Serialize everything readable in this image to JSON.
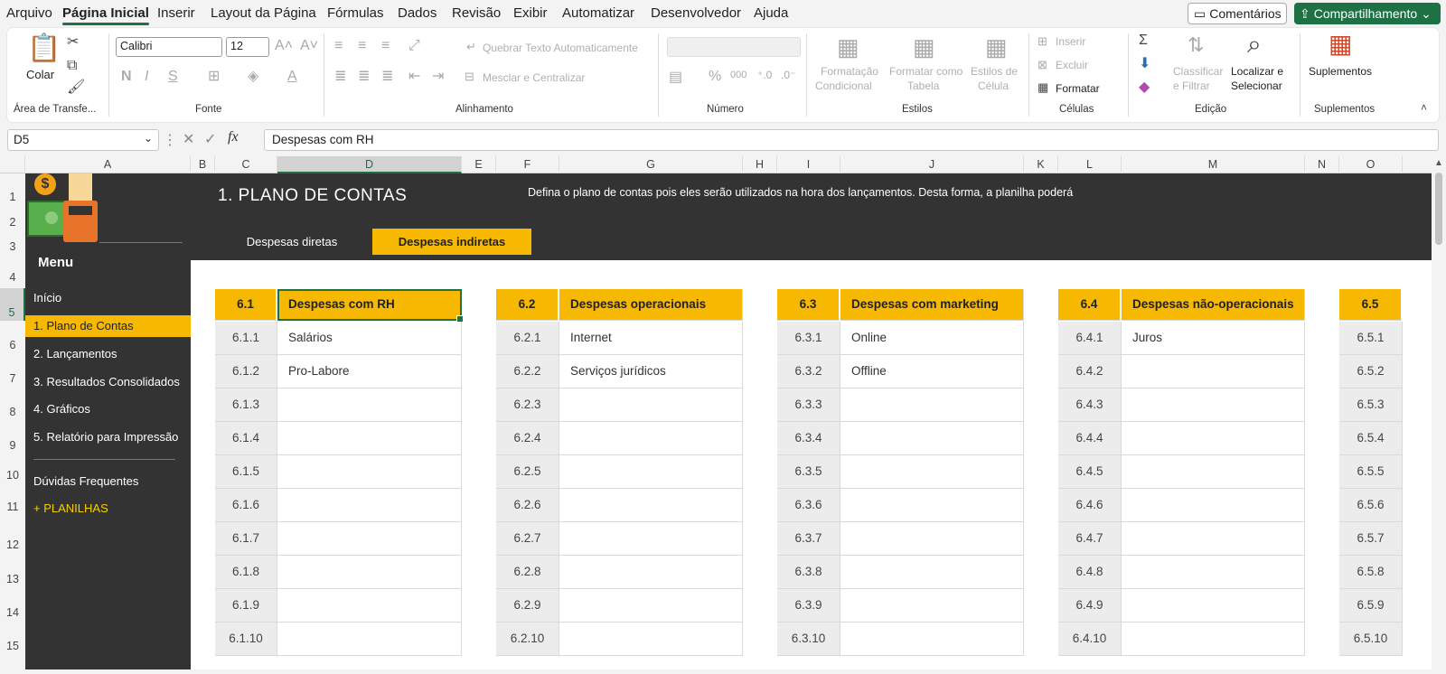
{
  "menu": {
    "tabs": [
      "Arquivo",
      "Página Inicial",
      "Inserir",
      "Layout da Página",
      "Fórmulas",
      "Dados",
      "Revisão",
      "Exibir",
      "Automatizar",
      "Desenvolvedor",
      "Ajuda"
    ],
    "active_tab": "Página Inicial",
    "comments": "Comentários",
    "share": "Compartilhamento"
  },
  "ribbon": {
    "clipboard": {
      "paste": "Colar",
      "label": "Área de Transfe..."
    },
    "font": {
      "family": "Calibri",
      "size": "12",
      "label": "Fonte"
    },
    "alignment": {
      "wrap": "Quebrar Texto Automaticamente",
      "merge": "Mesclar e Centralizar",
      "label": "Alinhamento"
    },
    "number": {
      "label": "Número"
    },
    "styles": {
      "conditional": [
        "Formatação",
        "Condicional"
      ],
      "table": [
        "Formatar como",
        "Tabela"
      ],
      "cell": [
        "Estilos de",
        "Célula"
      ],
      "label": "Estilos"
    },
    "cells": {
      "insert": "Inserir",
      "delete": "Excluir",
      "format": "Formatar",
      "label": "Células"
    },
    "editing": {
      "sort": [
        "Classificar",
        "e Filtrar"
      ],
      "find": [
        "Localizar e",
        "Selecionar"
      ],
      "label": "Edição"
    },
    "addins": {
      "button": "Suplementos",
      "label": "Suplementos"
    }
  },
  "formula_bar": {
    "name_box": "D5",
    "formula": "Despesas com RH"
  },
  "columns": [
    "A",
    "B",
    "C",
    "D",
    "E",
    "F",
    "G",
    "H",
    "I",
    "J",
    "K",
    "L",
    "M",
    "N",
    "O"
  ],
  "selected_column": "D",
  "rows": [
    "1",
    "2",
    "3",
    "4",
    "5",
    "6",
    "7",
    "8",
    "9",
    "10",
    "11",
    "12",
    "13",
    "14",
    "15"
  ],
  "selected_row": "5",
  "sheet": {
    "title": "1. PLANO DE CONTAS",
    "description": "Defina o plano de contas pois eles serão utilizados na hora dos lançamentos. Desta forma, a planilha poderá",
    "subtabs": [
      "Despesas diretas",
      "Despesas indiretas"
    ],
    "active_subtab": "Despesas indiretas",
    "menu_title": "Menu",
    "nav": [
      "Início",
      "1. Plano de Contas",
      "2. Lançamentos",
      "3. Resultados Consolidados",
      "4. Gráficos",
      "5. Relatório para Impressão",
      "Dúvidas Frequentes",
      "+ PLANILHAS"
    ],
    "active_nav": "1. Plano de Contas",
    "accent": "#f6b800",
    "dark": "#333333"
  },
  "tables": [
    {
      "code": "6.1",
      "title": "Despesas com RH",
      "items": [
        {
          "code": "6.1.1",
          "name": "Salários"
        },
        {
          "code": "6.1.2",
          "name": "Pro-Labore"
        },
        {
          "code": "6.1.3",
          "name": ""
        },
        {
          "code": "6.1.4",
          "name": ""
        },
        {
          "code": "6.1.5",
          "name": ""
        },
        {
          "code": "6.1.6",
          "name": ""
        },
        {
          "code": "6.1.7",
          "name": ""
        },
        {
          "code": "6.1.8",
          "name": ""
        },
        {
          "code": "6.1.9",
          "name": ""
        },
        {
          "code": "6.1.10",
          "name": ""
        }
      ]
    },
    {
      "code": "6.2",
      "title": "Despesas operacionais",
      "items": [
        {
          "code": "6.2.1",
          "name": "Internet"
        },
        {
          "code": "6.2.2",
          "name": "Serviços jurídicos"
        },
        {
          "code": "6.2.3",
          "name": ""
        },
        {
          "code": "6.2.4",
          "name": ""
        },
        {
          "code": "6.2.5",
          "name": ""
        },
        {
          "code": "6.2.6",
          "name": ""
        },
        {
          "code": "6.2.7",
          "name": ""
        },
        {
          "code": "6.2.8",
          "name": ""
        },
        {
          "code": "6.2.9",
          "name": ""
        },
        {
          "code": "6.2.10",
          "name": ""
        }
      ]
    },
    {
      "code": "6.3",
      "title": "Despesas com marketing",
      "items": [
        {
          "code": "6.3.1",
          "name": "Online"
        },
        {
          "code": "6.3.2",
          "name": "Offline"
        },
        {
          "code": "6.3.3",
          "name": ""
        },
        {
          "code": "6.3.4",
          "name": ""
        },
        {
          "code": "6.3.5",
          "name": ""
        },
        {
          "code": "6.3.6",
          "name": ""
        },
        {
          "code": "6.3.7",
          "name": ""
        },
        {
          "code": "6.3.8",
          "name": ""
        },
        {
          "code": "6.3.9",
          "name": ""
        },
        {
          "code": "6.3.10",
          "name": ""
        }
      ]
    },
    {
      "code": "6.4",
      "title": "Despesas não-operacionais",
      "items": [
        {
          "code": "6.4.1",
          "name": "Juros"
        },
        {
          "code": "6.4.2",
          "name": ""
        },
        {
          "code": "6.4.3",
          "name": ""
        },
        {
          "code": "6.4.4",
          "name": ""
        },
        {
          "code": "6.4.5",
          "name": ""
        },
        {
          "code": "6.4.6",
          "name": ""
        },
        {
          "code": "6.4.7",
          "name": ""
        },
        {
          "code": "6.4.8",
          "name": ""
        },
        {
          "code": "6.4.9",
          "name": ""
        },
        {
          "code": "6.4.10",
          "name": ""
        }
      ]
    },
    {
      "code": "6.5",
      "title": "",
      "items": [
        {
          "code": "6.5.1",
          "name": ""
        },
        {
          "code": "6.5.2",
          "name": ""
        },
        {
          "code": "6.5.3",
          "name": ""
        },
        {
          "code": "6.5.4",
          "name": ""
        },
        {
          "code": "6.5.5",
          "name": ""
        },
        {
          "code": "6.5.6",
          "name": ""
        },
        {
          "code": "6.5.7",
          "name": ""
        },
        {
          "code": "6.5.8",
          "name": ""
        },
        {
          "code": "6.5.9",
          "name": ""
        },
        {
          "code": "6.5.10",
          "name": ""
        }
      ]
    }
  ]
}
